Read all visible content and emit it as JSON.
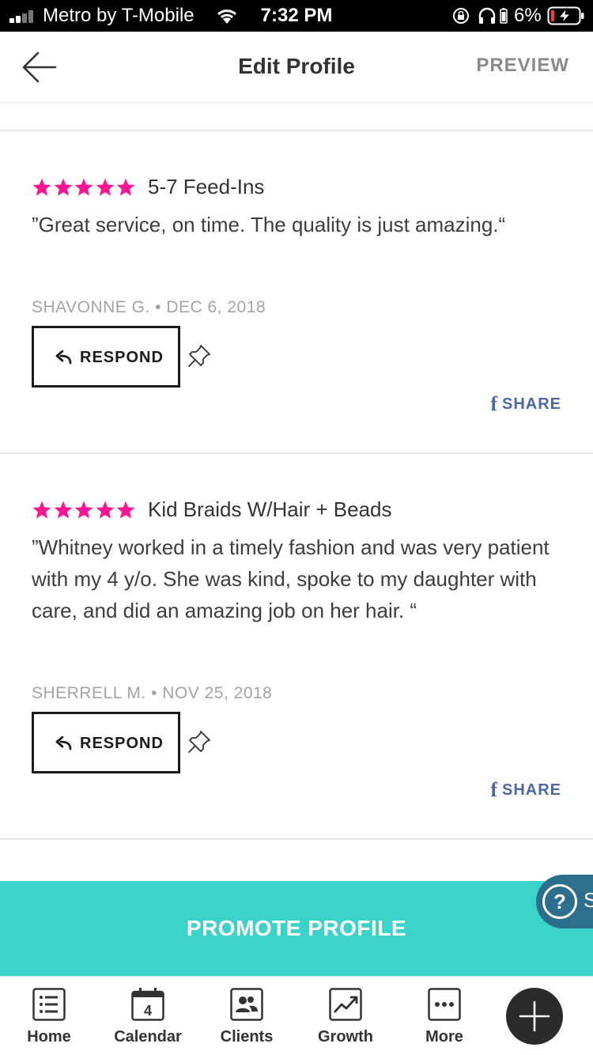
{
  "status_bar": {
    "carrier": "Metro by T-Mobile",
    "time": "7:32 PM",
    "battery": "6%"
  },
  "header": {
    "title": "Edit Profile",
    "preview_label": "PREVIEW"
  },
  "reviews": [
    {
      "rating": 5,
      "service": "5-7 Feed-Ins",
      "text": "”Great service, on time. The quality is just amazing.“",
      "meta": "SHAVONNE G. • DEC 6, 2018",
      "respond_label": "RESPOND",
      "share_label": "SHARE"
    },
    {
      "rating": 5,
      "service": "Kid Braids W/Hair + Beads",
      "text": "”Whitney worked in a timely fashion and was very patient with my 4 y/o. She was kind, spoke to my daughter with care, and did an amazing job on her hair. “",
      "meta": "SHERRELL M. • NOV 25, 2018",
      "respond_label": "RESPOND",
      "share_label": "SHARE"
    }
  ],
  "promote": {
    "label": "PROMOTE PROFILE"
  },
  "help": {
    "glyph": "?",
    "partial_text": "S"
  },
  "tabbar": {
    "calendar_day": "4",
    "tabs": [
      {
        "label": "Home",
        "icon": "list-icon"
      },
      {
        "label": "Calendar",
        "icon": "calendar-icon"
      },
      {
        "label": "Clients",
        "icon": "clients-icon"
      },
      {
        "label": "Growth",
        "icon": "growth-chart-icon"
      },
      {
        "label": "More",
        "icon": "more-dots-icon"
      }
    ]
  },
  "colors": {
    "star": "#ff1493",
    "promote_bg": "#3ad2c9",
    "share": "#4a67a8",
    "help_bg": "#2c6e8c",
    "fab_bg": "#2b2b2b"
  }
}
